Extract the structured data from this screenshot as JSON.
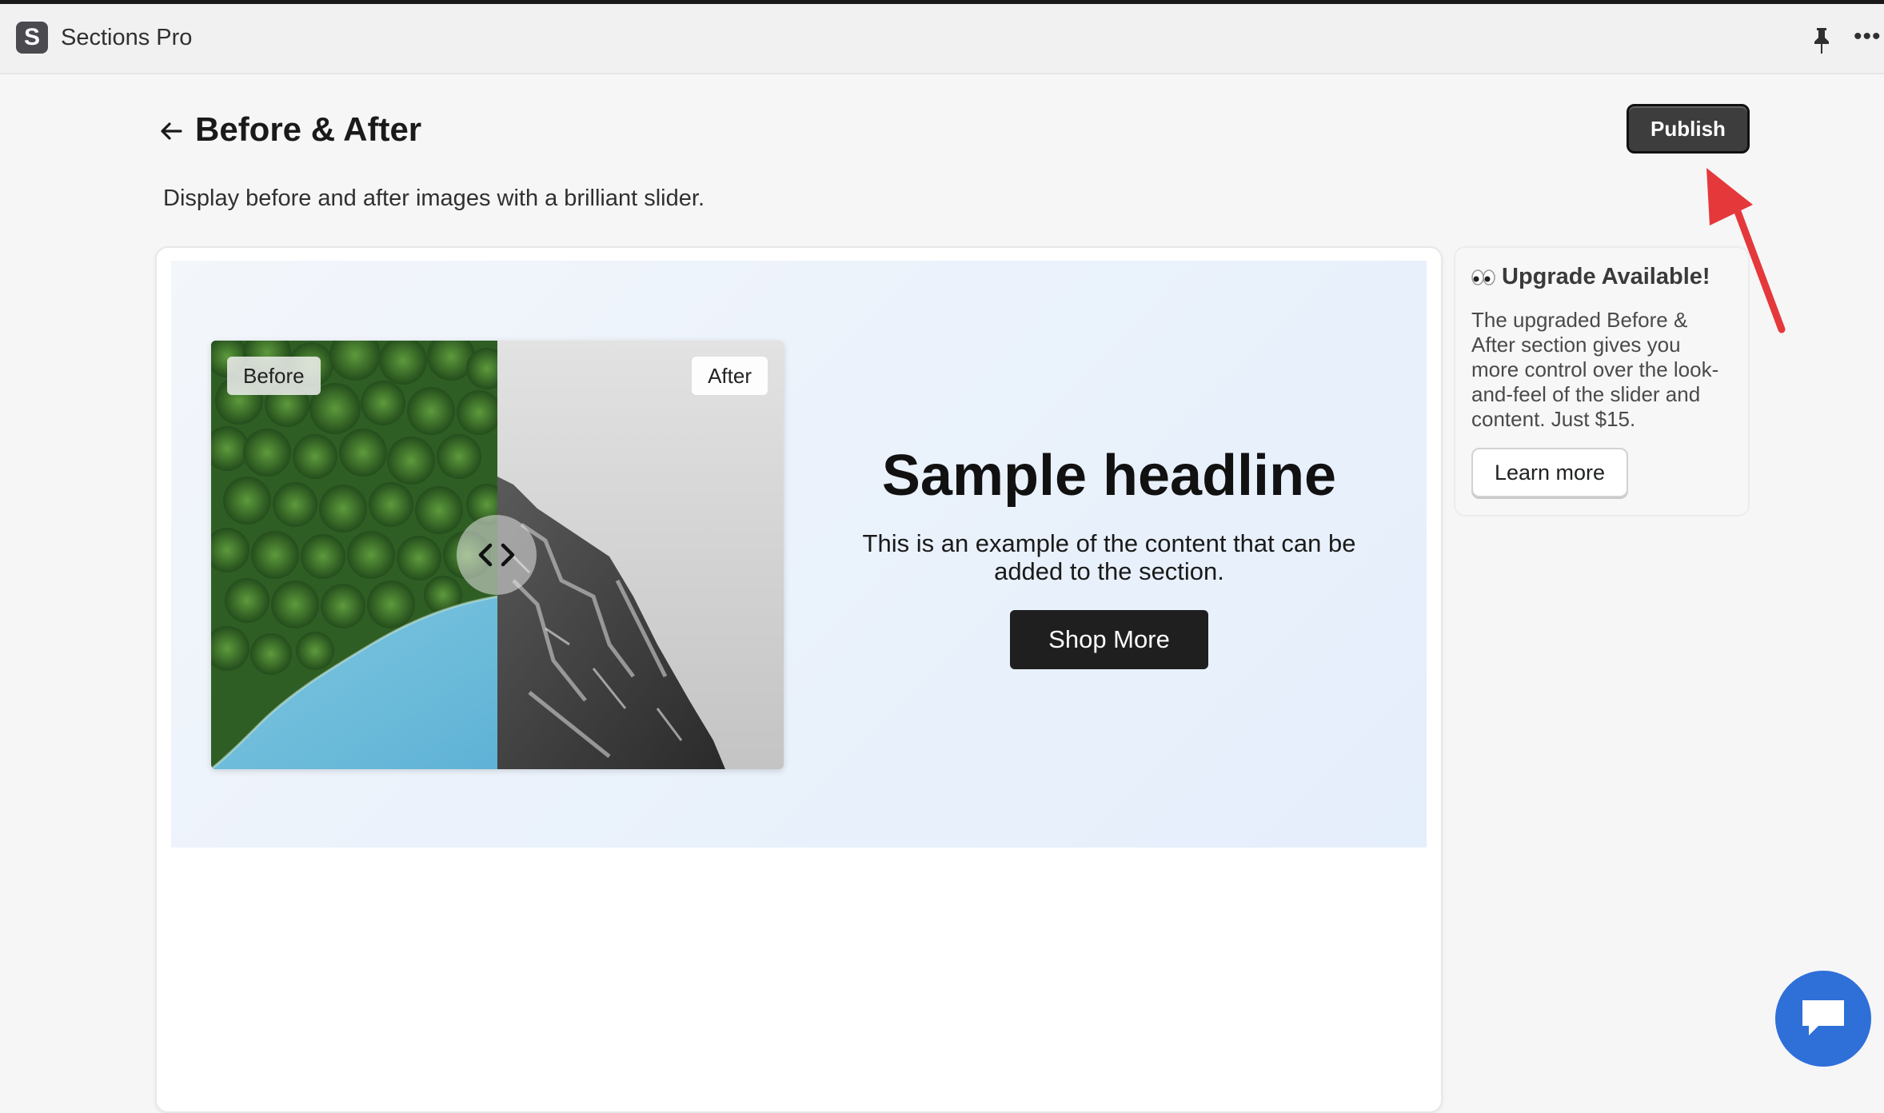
{
  "app": {
    "name": "Sections Pro",
    "logo_letter": "S"
  },
  "header": {
    "title": "Before & After",
    "subtitle": "Display before and after images with a brilliant slider.",
    "publish_label": "Publish"
  },
  "preview": {
    "before_label": "Before",
    "after_label": "After",
    "headline": "Sample headline",
    "body": "This is an example of the content that can be added to the section.",
    "cta_label": "Shop More"
  },
  "upgrade": {
    "emoji": "👀",
    "title": "Upgrade Available!",
    "body": "The upgraded Before & After section gives you more control over the look-and-feel of the slider and content. Just $15.",
    "cta_label": "Learn more"
  },
  "icons": {
    "back": "arrow-left-icon",
    "pin": "pin-icon",
    "more": "more-horizontal-icon",
    "handle": "code-arrows-icon",
    "chat": "chat-icon",
    "annotation": "red-arrow-annotation"
  },
  "colors": {
    "accent_chat": "#2f6fd8",
    "annotation": "#e5383b",
    "publish_bg": "#3d3d3d"
  }
}
